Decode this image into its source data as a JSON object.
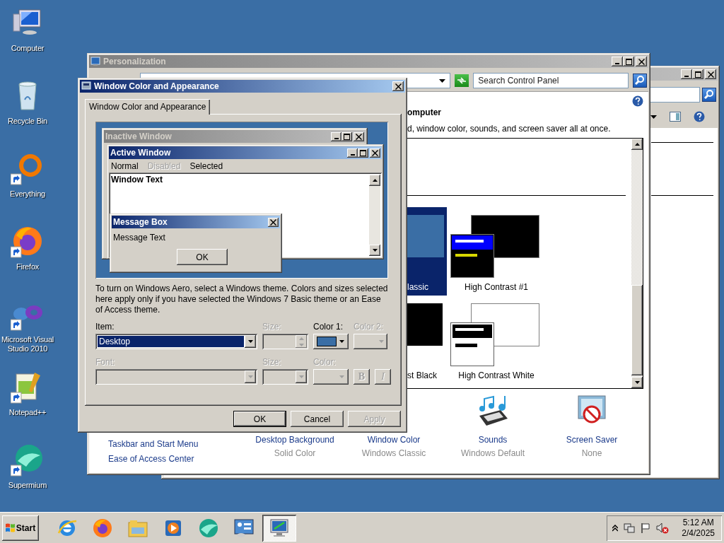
{
  "desktop_icons": [
    {
      "label": "Computer",
      "kind": "computer",
      "shortcut": false
    },
    {
      "label": "Recycle Bin",
      "kind": "recycle",
      "shortcut": false
    },
    {
      "label": "Everything",
      "kind": "everything",
      "shortcut": true
    },
    {
      "label": "Firefox",
      "kind": "firefox",
      "shortcut": true
    },
    {
      "label": "Microsoft Visual Studio 2010",
      "kind": "vs",
      "shortcut": true
    },
    {
      "label": "Notepad++",
      "kind": "notepad",
      "shortcut": true
    },
    {
      "label": "Supermium",
      "kind": "supermium",
      "shortcut": true
    }
  ],
  "personalization": {
    "title": "Personalization",
    "search": {
      "placeholder": "Search Control Panel"
    },
    "heading": "omputer",
    "description": "d, window color, sounds, and screen saver all at once.",
    "themes": [
      {
        "name": "lassic",
        "kind": "classic",
        "selected": true
      },
      {
        "name": "High Contrast #1",
        "kind": "hc1",
        "selected": false
      },
      {
        "name": "st Black",
        "kind": "hcblack",
        "selected": false
      },
      {
        "name": "High Contrast White",
        "kind": "hcwhite",
        "selected": false
      }
    ],
    "links": [
      "Taskbar and Start Menu",
      "Ease of Access Center"
    ],
    "settings": [
      {
        "label": "Desktop Background",
        "value": "Solid Color",
        "kind": "background"
      },
      {
        "label": "Window Color",
        "value": "Windows Classic",
        "kind": "color"
      },
      {
        "label": "Sounds",
        "value": "Windows Default",
        "kind": "sounds"
      },
      {
        "label": "Screen Saver",
        "value": "None",
        "kind": "screensaver"
      }
    ]
  },
  "dialog": {
    "title": "Window Color and Appearance",
    "tabs": [
      {
        "label": "Window Color and Appearance",
        "selected": true
      }
    ],
    "preview": {
      "inactive_title": "Inactive Window",
      "active_title": "Active Window",
      "menu": [
        {
          "label": "Normal",
          "disabled": false
        },
        {
          "label": "Disabled",
          "disabled": true
        },
        {
          "label": "Selected",
          "disabled": false
        }
      ],
      "window_text": "Window Text",
      "message_title": "Message Box",
      "message_text": "Message Text",
      "message_button": "OK"
    },
    "note": "To turn on Windows Aero, select a Windows theme.  Colors and sizes selected here apply only if you have selected the Windows 7 Basic theme or an Ease of Access theme.",
    "rows": [
      [
        {
          "kind": "combo",
          "label": "Item:",
          "value": "Desktop",
          "disabled": false
        },
        {
          "kind": "spin",
          "label": "Size:",
          "disabled": true
        },
        {
          "kind": "color",
          "label": "Color 1:",
          "color": "#3a6ea5",
          "disabled": false
        },
        {
          "kind": "color",
          "label": "Color 2:",
          "disabled": true
        }
      ],
      [
        {
          "kind": "combo",
          "label": "Font:",
          "disabled": true
        },
        {
          "kind": "combo",
          "label": "Size:",
          "disabled": true
        },
        {
          "kind": "color",
          "label": "Color:",
          "disabled": true
        },
        {
          "kind": "bold",
          "text": "B",
          "disabled": true
        },
        {
          "kind": "italic",
          "text": "I",
          "disabled": true
        }
      ]
    ],
    "buttons": [
      {
        "label": "OK",
        "disabled": false,
        "default": true
      },
      {
        "label": "Cancel",
        "disabled": false,
        "default": false
      },
      {
        "label": "Apply",
        "disabled": true,
        "default": false
      }
    ]
  },
  "taskbar": {
    "start": "Start",
    "apps": [
      {
        "kind": "ie",
        "selected": false
      },
      {
        "kind": "firefox",
        "selected": false
      },
      {
        "kind": "explorer",
        "selected": false
      },
      {
        "kind": "media",
        "selected": false
      },
      {
        "kind": "supermium",
        "selected": false
      },
      {
        "kind": "control",
        "selected": false
      },
      {
        "kind": "display",
        "selected": true
      }
    ],
    "time": "5:12 AM",
    "date": "2/4/2025"
  }
}
